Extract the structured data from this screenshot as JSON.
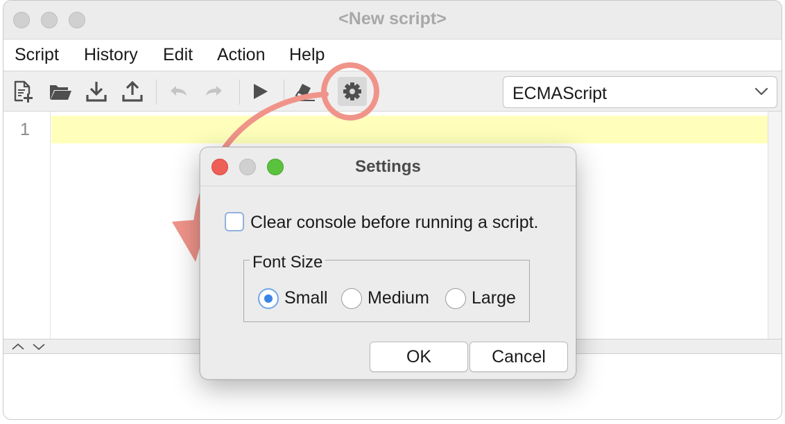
{
  "window": {
    "title": "<New script>"
  },
  "menubar": {
    "items": [
      "Script",
      "History",
      "Edit",
      "Action",
      "Help"
    ]
  },
  "toolbar": {
    "icons": [
      "new-script-icon",
      "open-folder-icon",
      "import-icon",
      "export-icon",
      "undo-icon",
      "redo-icon",
      "run-icon",
      "eraser-icon",
      "gear-icon"
    ],
    "language": "ECMAScript"
  },
  "editor": {
    "line_number": "1",
    "current_line_color": "#ffffbb"
  },
  "annotation": {
    "color": "#f0948a"
  },
  "dialog": {
    "title": "Settings",
    "clear_console_label": "Clear console before running a script.",
    "clear_console_checked": false,
    "font_size_legend": "Font Size",
    "font_sizes": [
      {
        "label": "Small",
        "selected": true
      },
      {
        "label": "Medium",
        "selected": false
      },
      {
        "label": "Large",
        "selected": false
      }
    ],
    "ok_label": "OK",
    "cancel_label": "Cancel",
    "traffic_colors": {
      "close": "#ee5f57",
      "minimize": "#d0d0d0",
      "zoom": "#5ac23d"
    }
  }
}
